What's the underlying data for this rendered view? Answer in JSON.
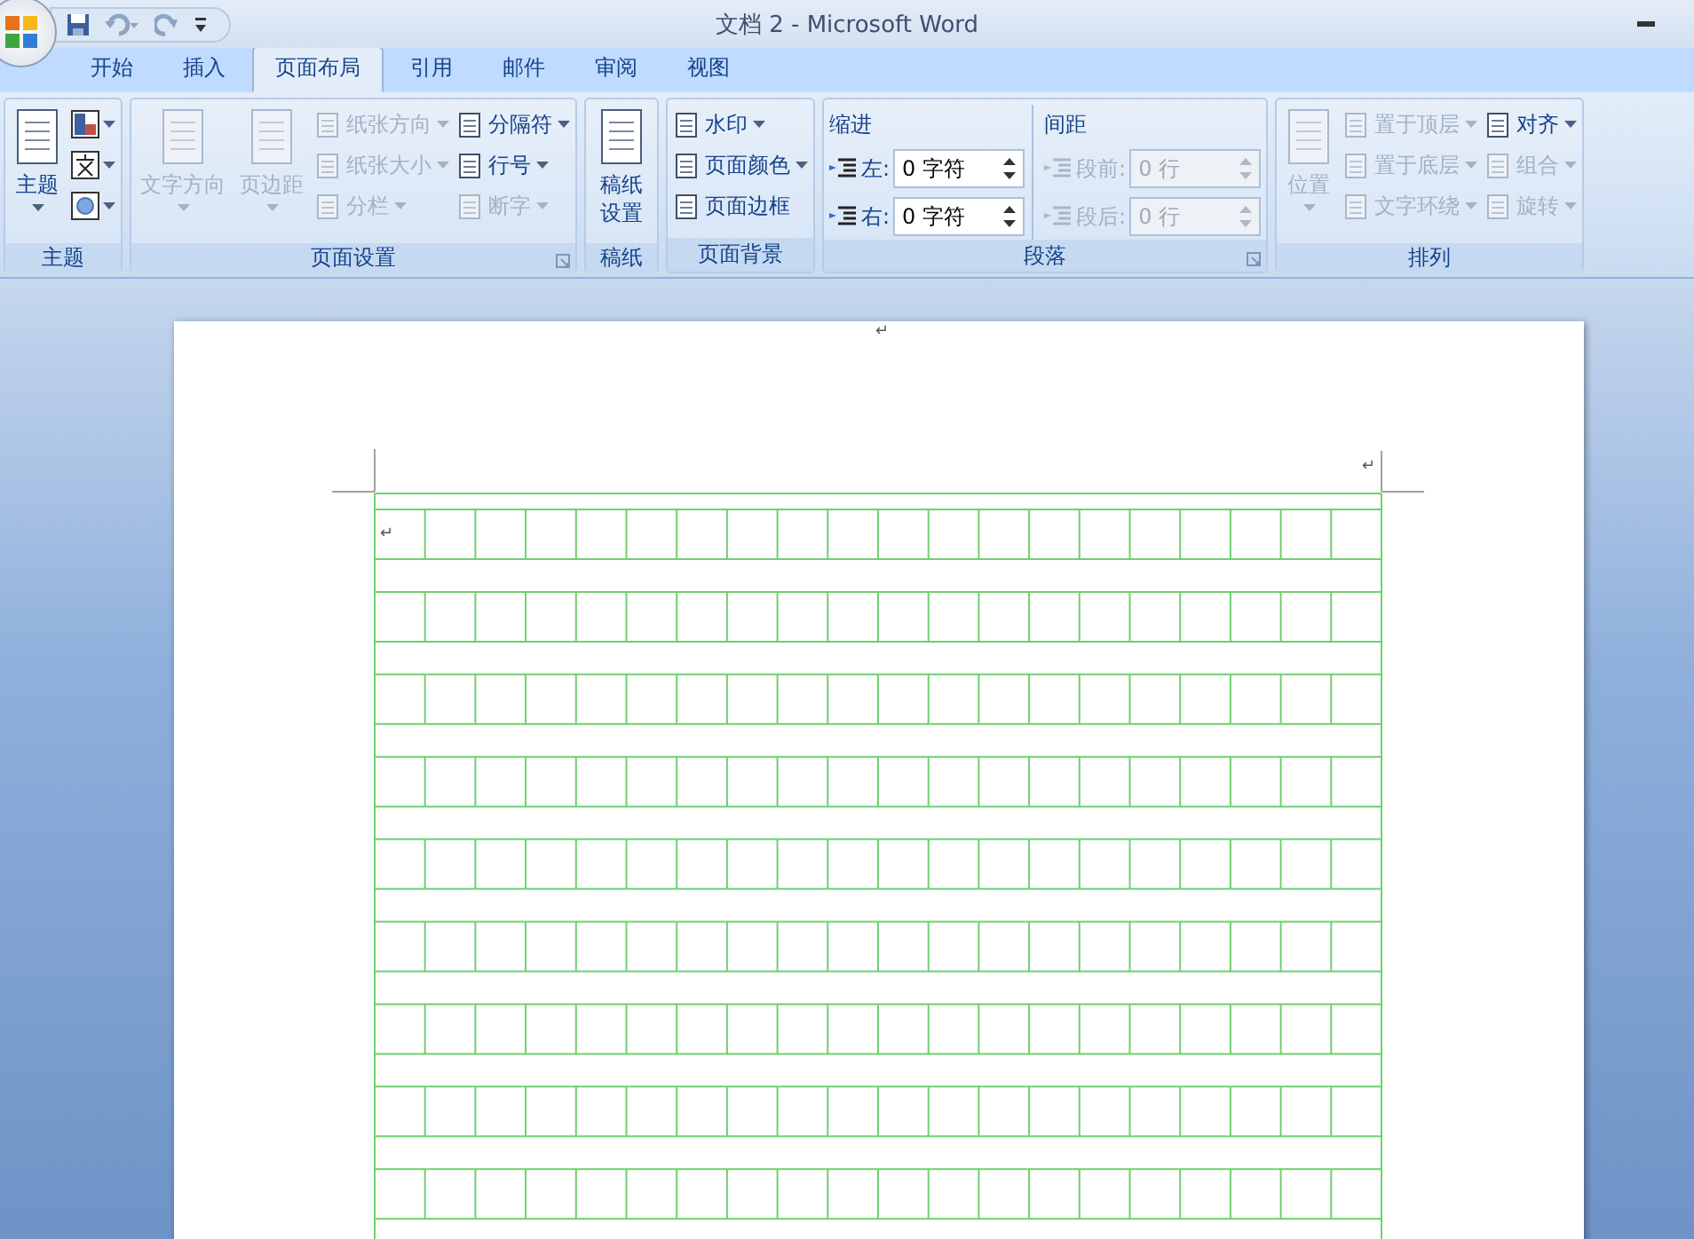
{
  "window": {
    "title": "文档 2 - Microsoft Word"
  },
  "tabs": [
    {
      "label": "开始",
      "selected": false
    },
    {
      "label": "插入",
      "selected": false
    },
    {
      "label": "页面布局",
      "selected": true
    },
    {
      "label": "引用",
      "selected": false
    },
    {
      "label": "邮件",
      "selected": false
    },
    {
      "label": "审阅",
      "selected": false
    },
    {
      "label": "视图",
      "selected": false
    }
  ],
  "ribbon": {
    "groups": [
      {
        "label": "主题",
        "launcher": false,
        "columns": [
          [
            {
              "kind": "large",
              "label": "主题",
              "dropdown": true,
              "disabled": false
            }
          ],
          [
            {
              "kind": "icon",
              "dropdown": true,
              "disabled": false
            },
            {
              "kind": "icon",
              "dropdown": true,
              "disabled": false
            },
            {
              "kind": "icon",
              "dropdown": true,
              "disabled": false
            }
          ]
        ]
      },
      {
        "label": "页面设置",
        "launcher": true,
        "columns": [
          [
            {
              "kind": "large",
              "label": "文字方向",
              "dropdown": true,
              "disabled": true
            }
          ],
          [
            {
              "kind": "large",
              "label": "页边距",
              "dropdown": true,
              "disabled": true
            }
          ],
          [
            {
              "kind": "small",
              "label": "纸张方向",
              "dropdown": true,
              "disabled": true
            },
            {
              "kind": "small",
              "label": "纸张大小",
              "dropdown": true,
              "disabled": true
            },
            {
              "kind": "small",
              "label": "分栏",
              "dropdown": true,
              "disabled": true
            }
          ],
          [
            {
              "kind": "small",
              "label": "分隔符",
              "dropdown": true,
              "disabled": false
            },
            {
              "kind": "small",
              "label": "行号",
              "dropdown": true,
              "disabled": false
            },
            {
              "kind": "small",
              "label": "断字",
              "dropdown": true,
              "disabled": true
            }
          ]
        ]
      },
      {
        "label": "稿纸",
        "launcher": false,
        "columns": [
          [
            {
              "kind": "large",
              "label": "稿纸设置",
              "dropdown": false,
              "disabled": false
            }
          ]
        ]
      },
      {
        "label": "页面背景",
        "launcher": false,
        "columns": [
          [
            {
              "kind": "small",
              "label": "水印",
              "dropdown": true,
              "disabled": false
            },
            {
              "kind": "small",
              "label": "页面颜色",
              "dropdown": true,
              "disabled": false
            },
            {
              "kind": "small",
              "label": "页面边框",
              "dropdown": false,
              "disabled": false
            }
          ]
        ]
      },
      {
        "label": "段落",
        "launcher": true,
        "columns": [
          [
            {
              "kind": "heading",
              "label": "缩进"
            },
            {
              "kind": "spinner",
              "label": "左:",
              "value": "0 字符",
              "disabled": false
            },
            {
              "kind": "spinner",
              "label": "右:",
              "value": "0 字符",
              "disabled": false
            }
          ],
          [
            {
              "kind": "heading",
              "label": "间距"
            },
            {
              "kind": "spinner",
              "label": "段前:",
              "value": "0 行",
              "disabled": true
            },
            {
              "kind": "spinner",
              "label": "段后:",
              "value": "0 行",
              "disabled": true
            }
          ]
        ]
      },
      {
        "label": "排列",
        "launcher": false,
        "columns": [
          [
            {
              "kind": "large",
              "label": "位置",
              "dropdown": true,
              "disabled": true
            }
          ],
          [
            {
              "kind": "small",
              "label": "置于顶层",
              "dropdown": true,
              "disabled": true
            },
            {
              "kind": "small",
              "label": "置于底层",
              "dropdown": true,
              "disabled": true
            },
            {
              "kind": "small",
              "label": "文字环绕",
              "dropdown": true,
              "disabled": true
            }
          ],
          [
            {
              "kind": "small",
              "label": "对齐",
              "dropdown": true,
              "disabled": false
            },
            {
              "kind": "small",
              "label": "组合",
              "dropdown": true,
              "disabled": true
            },
            {
              "kind": "small",
              "label": "旋转",
              "dropdown": true,
              "disabled": true
            }
          ]
        ]
      }
    ]
  },
  "document": {
    "paragraph_marks": [
      "↵",
      "↵",
      "↵"
    ]
  }
}
